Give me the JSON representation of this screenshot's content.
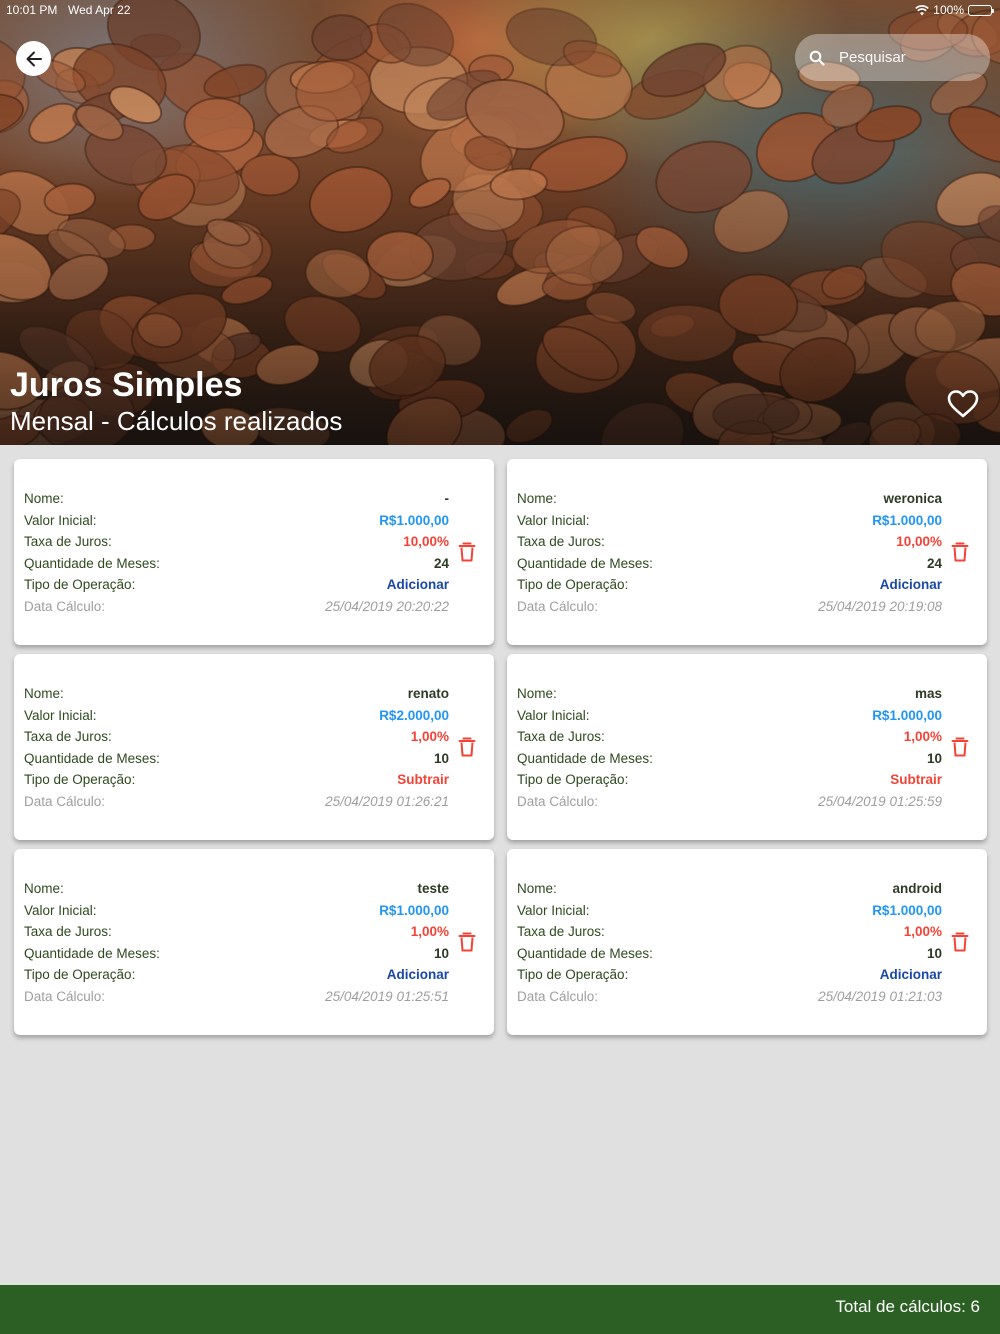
{
  "status_bar": {
    "time": "10:01 PM",
    "date": "Wed Apr 22",
    "battery": "100%"
  },
  "header": {
    "title": "Juros Simples",
    "subtitle": "Mensal - Cálculos realizados",
    "search_placeholder": "Pesquisar"
  },
  "labels": {
    "name": "Nome:",
    "initial_value": "Valor Inicial:",
    "interest_rate": "Taxa de Juros:",
    "months": "Quantidade de Meses:",
    "operation": "Tipo de Operação:",
    "date": "Data Cálculo:"
  },
  "cards": [
    {
      "name": "-",
      "initial_value": "R$1.000,00",
      "rate": "10,00%",
      "months": "24",
      "operation": "Adicionar",
      "date": "25/04/2019 20:20:22"
    },
    {
      "name": "weronica",
      "initial_value": "R$1.000,00",
      "rate": "10,00%",
      "months": "24",
      "operation": "Adicionar",
      "date": "25/04/2019 20:19:08"
    },
    {
      "name": "renato",
      "initial_value": "R$2.000,00",
      "rate": "1,00%",
      "months": "10",
      "operation": "Subtrair",
      "date": "25/04/2019 01:26:21"
    },
    {
      "name": "mas",
      "initial_value": "R$1.000,00",
      "rate": "1,00%",
      "months": "10",
      "operation": "Subtrair",
      "date": "25/04/2019 01:25:59"
    },
    {
      "name": "teste",
      "initial_value": "R$1.000,00",
      "rate": "1,00%",
      "months": "10",
      "operation": "Adicionar",
      "date": "25/04/2019 01:25:51"
    },
    {
      "name": "android",
      "initial_value": "R$1.000,00",
      "rate": "1,00%",
      "months": "10",
      "operation": "Adicionar",
      "date": "25/04/2019 01:21:03"
    }
  ],
  "footer": {
    "total_text": "Total de cálculos: 6"
  },
  "colors": {
    "footer_green": "#2c5f23",
    "money_blue": "#2196f3",
    "rate_red": "#f44336",
    "add_blue": "#1a47a8"
  },
  "icons": {
    "back": "arrow-left-icon",
    "search": "search-icon",
    "favorite": "heart-outline-icon",
    "delete": "trash-icon",
    "wifi": "wifi-icon",
    "battery": "battery-icon"
  }
}
